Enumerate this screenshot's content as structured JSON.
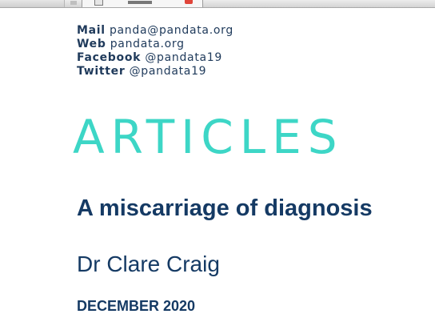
{
  "contact": {
    "mail_label": "Mail",
    "mail_value": "panda@pandata.org",
    "web_label": "Web",
    "web_value": "pandata.org",
    "facebook_label": "Facebook",
    "facebook_value": "@pandata19",
    "twitter_label": "Twitter",
    "twitter_value": "@pandata19"
  },
  "section_heading": "ARTICLES",
  "article": {
    "title": "A miscarriage of diagnosis",
    "author": "Dr Clare Craig",
    "date": "DECEMBER 2020"
  },
  "colors": {
    "navy": "#153a64",
    "teal": "#3dd6c6",
    "close_red": "#e0453a"
  },
  "icons": {
    "tab_favicon": "page-icon",
    "tab_close": "close-icon"
  }
}
